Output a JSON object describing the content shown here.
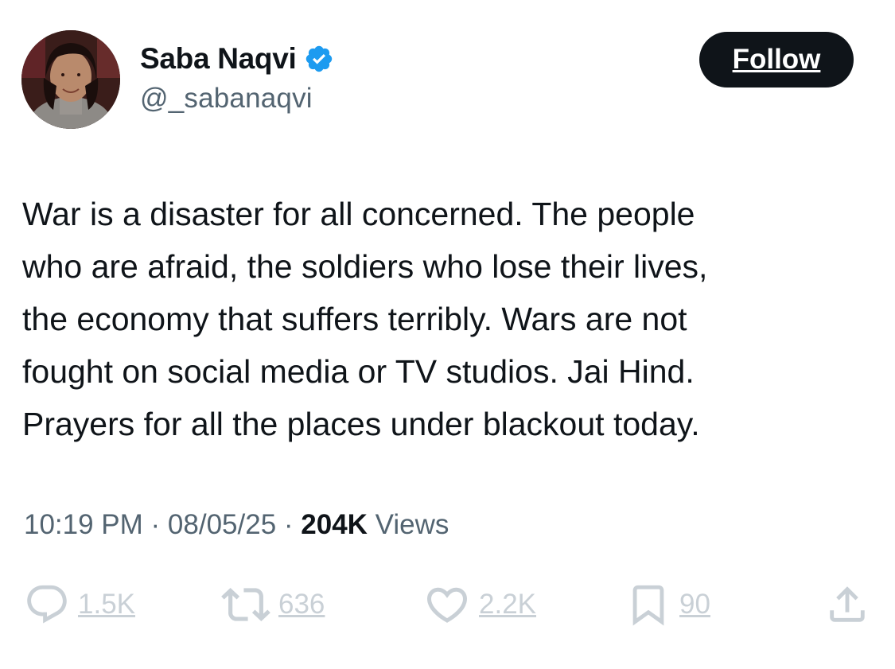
{
  "author": {
    "name": "Saba Naqvi",
    "handle": "@_sabanaqvi",
    "verified": true
  },
  "follow_label": "Follow",
  "tweet": {
    "lines": [
      "War is a disaster for all concerned. The people",
      "who are afraid, the soldiers who lose their lives,",
      "the economy that suffers terribly. Wars are not",
      "fought on social media or TV studios. Jai Hind.",
      "Prayers for all the places under blackout today."
    ]
  },
  "meta": {
    "time": "10:19 PM",
    "sep1": " · ",
    "date": "08/05/25",
    "sep2": " · ",
    "views_count": "204K",
    "views_label": " Views"
  },
  "actions": {
    "replies": "1.5K",
    "reposts": "636",
    "likes": "2.2K",
    "bookmarks": "90"
  },
  "colors": {
    "text": "#0f1419",
    "secondary": "#536471",
    "verified": "#1d9bf0",
    "action_faded": "#c9d0d6",
    "button_bg": "#0f1419"
  },
  "icons": [
    "verified-badge-icon",
    "reply-icon",
    "repost-icon",
    "like-icon",
    "bookmark-icon",
    "share-icon"
  ]
}
